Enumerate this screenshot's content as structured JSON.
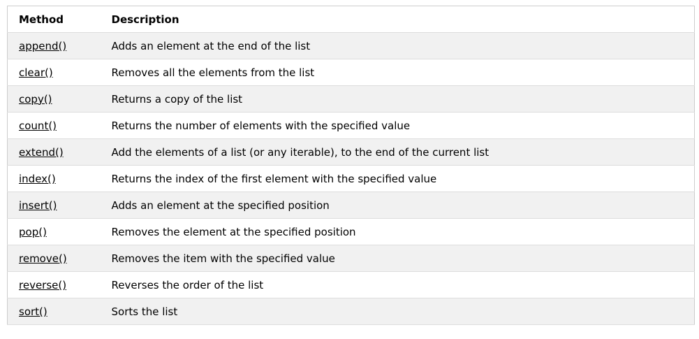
{
  "table": {
    "headers": {
      "method": "Method",
      "description": "Description"
    },
    "rows": [
      {
        "method": "append()",
        "description": "Adds an element at the end of the list"
      },
      {
        "method": "clear()",
        "description": "Removes all the elements from the list"
      },
      {
        "method": "copy()",
        "description": "Returns a copy of the list"
      },
      {
        "method": "count()",
        "description": "Returns the number of elements with the specified value"
      },
      {
        "method": "extend()",
        "description": "Add the elements of a list (or any iterable), to the end of the current list"
      },
      {
        "method": "index()",
        "description": "Returns the index of the first element with the specified value"
      },
      {
        "method": "insert()",
        "description": "Adds an element at the specified position"
      },
      {
        "method": "pop()",
        "description": "Removes the element at the specified position"
      },
      {
        "method": "remove()",
        "description": "Removes the item with the specified value"
      },
      {
        "method": "reverse()",
        "description": "Reverses the order of the list"
      },
      {
        "method": "sort()",
        "description": "Sorts the list"
      }
    ]
  },
  "colors": {
    "stripe": "#f1f1f1",
    "border": "#cccccc",
    "text": "#000000"
  }
}
